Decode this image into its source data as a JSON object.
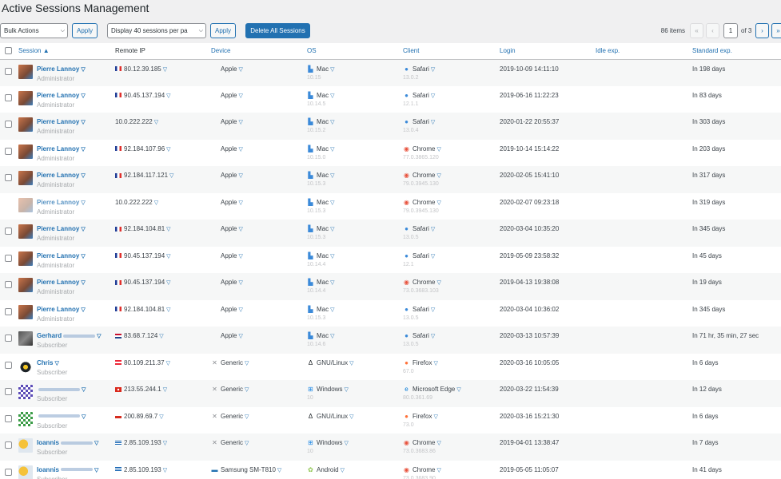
{
  "page_title": "Active Sessions Management",
  "toolbar": {
    "bulk_actions": "Bulk Actions",
    "apply": "Apply",
    "display_select": "Display 40 sessions per pa",
    "apply2": "Apply",
    "delete_all": "Delete All Sessions",
    "items_count": "86 items",
    "first": "«",
    "prev": "‹",
    "current_page": "1",
    "of_pages": "of 3",
    "next": "›",
    "last": "»"
  },
  "columns": {
    "session": "Session",
    "sort_indicator": "▲",
    "remote_ip": "Remote IP",
    "device": "Device",
    "os": "OS",
    "client": "Client",
    "login": "Login",
    "idle": "Idle exp.",
    "standard": "Standard exp."
  },
  "colors": {
    "link": "#2271b1",
    "primary_button": "#2271b1",
    "muted_text": "#a7aaad"
  },
  "rows": [
    {
      "user": "Pierre Lannoy",
      "role": "Administrator",
      "avatar": "photo",
      "ip": "80.12.39.185",
      "flag": "fr",
      "device": "Apple",
      "device_icon": "apple-icon",
      "os": "Mac",
      "os_ver": "10.15",
      "os_icon": "mac-icon",
      "client": "Safari",
      "client_ver": "13.0.2",
      "client_icon": "safari-icon",
      "login": "2019-10-09 14:11:10",
      "standard": "In 198 days"
    },
    {
      "user": "Pierre Lannoy",
      "role": "Administrator",
      "avatar": "photo",
      "ip": "90.45.137.194",
      "flag": "fr",
      "device": "Apple",
      "device_icon": "apple-icon",
      "os": "Mac",
      "os_ver": "10.14.5",
      "os_icon": "mac-icon",
      "client": "Safari",
      "client_ver": "12.1.1",
      "client_icon": "safari-icon",
      "login": "2019-06-16 11:22:23",
      "standard": "In 83 days"
    },
    {
      "user": "Pierre Lannoy",
      "role": "Administrator",
      "avatar": "photo",
      "ip": "10.0.222.222",
      "flag": "",
      "device": "Apple",
      "device_icon": "apple-icon",
      "os": "Mac",
      "os_ver": "10.15.2",
      "os_icon": "mac-icon",
      "client": "Safari",
      "client_ver": "13.0.4",
      "client_icon": "safari-icon",
      "login": "2020-01-22 20:55:37",
      "standard": "In 303 days"
    },
    {
      "user": "Pierre Lannoy",
      "role": "Administrator",
      "avatar": "photo",
      "ip": "92.184.107.96",
      "flag": "fr",
      "device": "Apple",
      "device_icon": "apple-icon",
      "os": "Mac",
      "os_ver": "10.15.0",
      "os_icon": "mac-icon",
      "client": "Chrome",
      "client_ver": "77.0.3865.120",
      "client_icon": "chrome-icon",
      "login": "2019-10-14 15:14:22",
      "standard": "In 203 days"
    },
    {
      "user": "Pierre Lannoy",
      "role": "Administrator",
      "avatar": "photo",
      "ip": "92.184.117.121",
      "flag": "fr",
      "device": "Apple",
      "device_icon": "apple-icon",
      "os": "Mac",
      "os_ver": "10.15.3",
      "os_icon": "mac-icon",
      "client": "Chrome",
      "client_ver": "79.0.3945.130",
      "client_icon": "chrome-icon",
      "login": "2020-02-05 15:41:10",
      "standard": "In 317 days"
    },
    {
      "user": "Pierre Lannoy",
      "role": "Administrator",
      "avatar": "photo-faded",
      "ip": "10.0.222.222",
      "flag": "",
      "device": "Apple",
      "device_icon": "apple-icon",
      "os": "Mac",
      "os_ver": "10.15.3",
      "os_icon": "mac-icon",
      "client": "Chrome",
      "client_ver": "79.0.3945.130",
      "client_icon": "chrome-icon",
      "login": "2020-02-07 09:23:18",
      "standard": "In 319 days",
      "current": true
    },
    {
      "user": "Pierre Lannoy",
      "role": "Administrator",
      "avatar": "photo",
      "ip": "92.184.104.81",
      "flag": "fr",
      "device": "Apple",
      "device_icon": "apple-icon",
      "os": "Mac",
      "os_ver": "10.15.3",
      "os_icon": "mac-icon",
      "client": "Safari",
      "client_ver": "13.0.5",
      "client_icon": "safari-icon",
      "login": "2020-03-04 10:35:20",
      "standard": "In 345 days"
    },
    {
      "user": "Pierre Lannoy",
      "role": "Administrator",
      "avatar": "photo",
      "ip": "90.45.137.194",
      "flag": "fr",
      "device": "Apple",
      "device_icon": "apple-icon",
      "os": "Mac",
      "os_ver": "10.14.4",
      "os_icon": "mac-icon",
      "client": "Safari",
      "client_ver": "12.1",
      "client_icon": "safari-icon",
      "login": "2019-05-09 23:58:32",
      "standard": "In 45 days"
    },
    {
      "user": "Pierre Lannoy",
      "role": "Administrator",
      "avatar": "photo",
      "ip": "90.45.137.194",
      "flag": "fr",
      "device": "Apple",
      "device_icon": "apple-icon",
      "os": "Mac",
      "os_ver": "10.14.4",
      "os_icon": "mac-icon",
      "client": "Chrome",
      "client_ver": "73.0.3683.103",
      "client_icon": "chrome-icon",
      "login": "2019-04-13 19:38:08",
      "standard": "In 19 days"
    },
    {
      "user": "Pierre Lannoy",
      "role": "Administrator",
      "avatar": "photo",
      "ip": "92.184.104.81",
      "flag": "fr",
      "device": "Apple",
      "device_icon": "apple-icon",
      "os": "Mac",
      "os_ver": "10.15.3",
      "os_icon": "mac-icon",
      "client": "Safari",
      "client_ver": "13.0.5",
      "client_icon": "safari-icon",
      "login": "2020-03-04 10:36:02",
      "standard": "In 345 days"
    },
    {
      "user": "Gerhard",
      "role": "Subscriber",
      "avatar": "photo-dark",
      "ip": "83.68.7.124",
      "flag": "nl",
      "device": "Apple",
      "device_icon": "apple-icon",
      "os": "Mac",
      "os_ver": "10.14.6",
      "os_icon": "mac-icon",
      "client": "Safari",
      "client_ver": "13.0.5",
      "client_icon": "safari-icon",
      "login": "2020-03-13 10:57:39",
      "standard": "In 71 hr, 35 min, 27 sec",
      "blurred_name": true
    },
    {
      "user": "Chris",
      "role": "Subscriber",
      "avatar": "tux",
      "ip": "80.109.211.37",
      "flag": "at",
      "device": "Generic",
      "device_icon": "generic-icon",
      "os": "GNU/Linux",
      "os_ver": "",
      "os_icon": "linux-icon",
      "client": "Firefox",
      "client_ver": "67.0",
      "client_icon": "firefox-icon",
      "login": "2020-03-16 10:05:05",
      "standard": "In 6 days"
    },
    {
      "user": "",
      "role": "Subscriber",
      "avatar": "identicon-purple",
      "ip": "213.55.244.1",
      "flag": "ch",
      "device": "Generic",
      "device_icon": "generic-icon",
      "os": "Windows",
      "os_ver": "10",
      "os_icon": "windows-icon",
      "client": "Microsoft Edge",
      "client_ver": "80.0.361.69",
      "client_icon": "edge-icon",
      "login": "2020-03-22 11:54:39",
      "standard": "In 12 days",
      "blurred_name": true
    },
    {
      "user": "",
      "role": "Subscriber",
      "avatar": "identicon-green",
      "ip": "200.89.69.7",
      "flag": "cl",
      "device": "Generic",
      "device_icon": "generic-icon",
      "os": "GNU/Linux",
      "os_ver": "",
      "os_icon": "linux-icon",
      "client": "Firefox",
      "client_ver": "73.0",
      "client_icon": "firefox-icon",
      "login": "2020-03-16 15:21:30",
      "standard": "In 6 days",
      "blurred_name": true
    },
    {
      "user": "Ioannis",
      "role": "Subscriber",
      "avatar": "weather",
      "ip": "2.85.109.193",
      "flag": "gr",
      "device": "Generic",
      "device_icon": "generic-icon",
      "os": "Windows",
      "os_ver": "10",
      "os_icon": "windows-icon",
      "client": "Chrome",
      "client_ver": "73.0.3683.86",
      "client_icon": "chrome-icon",
      "login": "2019-04-01 13:38:47",
      "standard": "In 7 days",
      "blurred_name": true
    },
    {
      "user": "Ioannis",
      "role": "Subscriber",
      "avatar": "weather",
      "ip": "2.85.109.193",
      "flag": "gr",
      "device": "Samsung SM-T810",
      "device_icon": "tablet-icon",
      "os": "Android",
      "os_ver": "",
      "os_icon": "android-icon",
      "client": "Chrome",
      "client_ver": "73.0.3683.90",
      "client_icon": "chrome-icon",
      "login": "2019-05-05 11:05:07",
      "standard": "In 41 days",
      "blurred_name": true
    }
  ]
}
